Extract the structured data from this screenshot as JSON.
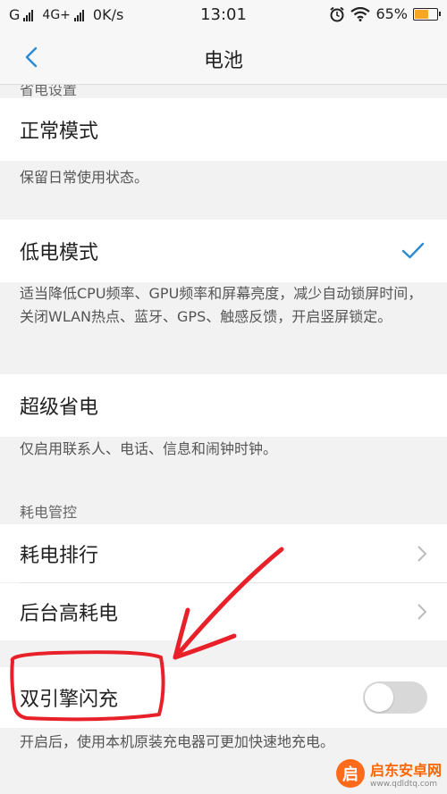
{
  "status_bar": {
    "carrier1": "G",
    "carrier2": "4G+",
    "speed": "0K/s",
    "time": "13:01",
    "battery_percent": "65%",
    "battery_level": 0.65,
    "battery_color": "#f5a623"
  },
  "nav": {
    "title": "电池",
    "back_icon": "chevron-left-icon",
    "accent": "#2a8ad4"
  },
  "section_power_settings": {
    "title": "省电设置",
    "modes": [
      {
        "label": "正常模式",
        "desc": "保留日常使用状态。",
        "selected": false
      },
      {
        "label": "低电模式",
        "desc": "适当降低CPU频率、GPU频率和屏幕亮度，减少自动锁屏时间，关闭WLAN热点、蓝牙、GPS、触感反馈，开启竖屏锁定。",
        "selected": true
      },
      {
        "label": "超级省电",
        "desc": "仅启用联系人、电话、信息和闹钟时钟。",
        "selected": false
      }
    ]
  },
  "section_power_control": {
    "title": "耗电管控",
    "items": [
      {
        "label": "耗电排行"
      },
      {
        "label": "后台高耗电"
      }
    ]
  },
  "flash_charge": {
    "label": "双引擎闪充",
    "desc": "开启后，使用本机原装充电器可更加快速地充电。",
    "enabled": false
  },
  "annotation": {
    "color": "#e8202a",
    "shapes": [
      "red-circle",
      "red-arrow"
    ]
  },
  "watermark": {
    "brand": "启东安卓网",
    "url": "www.qdldtq.com",
    "logo_glyph": "启"
  }
}
